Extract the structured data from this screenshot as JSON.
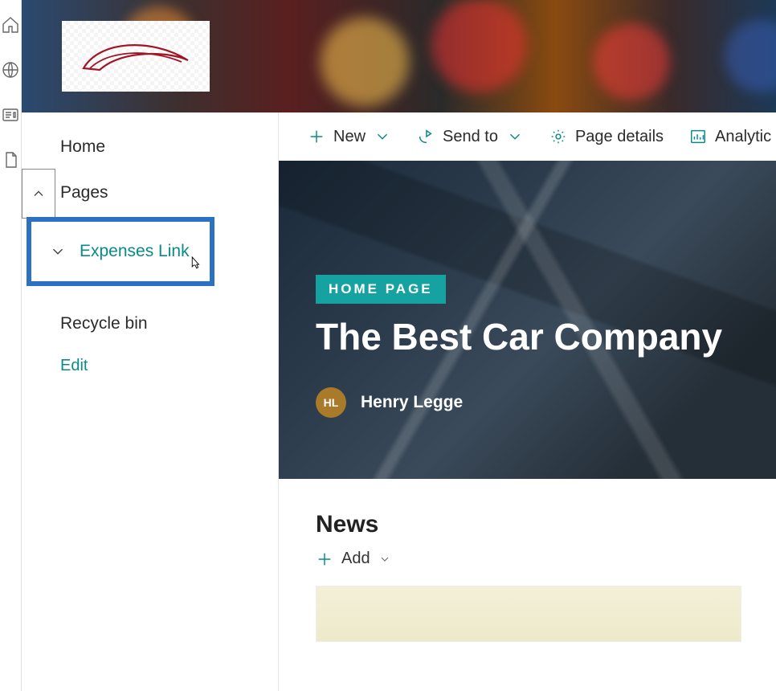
{
  "rail": {
    "items": [
      "home",
      "globe",
      "news",
      "page"
    ]
  },
  "sidenav": {
    "home": "Home",
    "pages": "Pages",
    "expenses": "Expenses Link",
    "recycle": "Recycle bin",
    "edit": "Edit"
  },
  "toolbar": {
    "new": "New",
    "sendto": "Send to",
    "pagedetails": "Page details",
    "analytics": "Analytic"
  },
  "hero": {
    "tag": "HOME PAGE",
    "title": "The Best Car Company",
    "author_initials": "HL",
    "author_name": "Henry Legge"
  },
  "news": {
    "heading": "News",
    "add": "Add"
  },
  "colors": {
    "teal": "#0a8a8a",
    "highlight": "#2b72c4"
  }
}
